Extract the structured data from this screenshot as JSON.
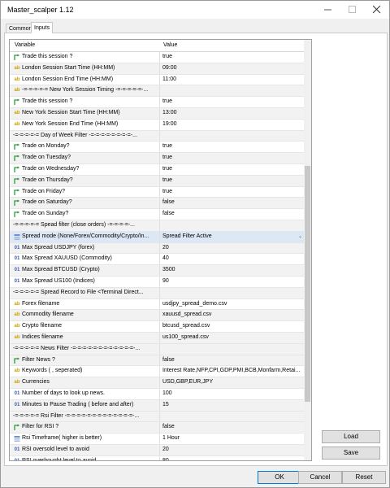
{
  "window": {
    "title": "Master_scalper 1.12"
  },
  "tabs": [
    {
      "label": "Common"
    },
    {
      "label": "Inputs"
    }
  ],
  "table": {
    "headers": {
      "variable": "Variable",
      "value": "Value"
    },
    "rows": [
      {
        "icon": "arrow",
        "variable": "Trade this session ?",
        "value": "true"
      },
      {
        "icon": "ab",
        "variable": "London Session Start Time (HH:MM)",
        "value": "09:00"
      },
      {
        "icon": "ab",
        "variable": "London Session End Time (HH:MM)",
        "value": "11:00"
      },
      {
        "icon": "ab",
        "variable": "-=-=-=-=-= New York Session Timing -=-=-=-=-=-...",
        "value": ""
      },
      {
        "icon": "arrow",
        "variable": "Trade this session ?",
        "value": "true"
      },
      {
        "icon": "ab",
        "variable": "New York Session Start Time (HH:MM)",
        "value": "13:00"
      },
      {
        "icon": "ab",
        "variable": "New York Session End Time (HH:MM)",
        "value": "19:00"
      },
      {
        "icon": "none",
        "variable": "-=-=-=-=-= Day of Week Filter -=-=-=-=-=-=-=-=-...",
        "value": ""
      },
      {
        "icon": "arrow",
        "variable": "Trade on Monday?",
        "value": "true"
      },
      {
        "icon": "arrow",
        "variable": "Trade on Tuesday?",
        "value": "true"
      },
      {
        "icon": "arrow",
        "variable": "Trade on Wednesday?",
        "value": "true"
      },
      {
        "icon": "arrow",
        "variable": "Trade on Thursday?",
        "value": "true"
      },
      {
        "icon": "arrow",
        "variable": "Trade on Friday?",
        "value": "true"
      },
      {
        "icon": "arrow",
        "variable": "Trade on Saturday?",
        "value": "false"
      },
      {
        "icon": "arrow",
        "variable": "Trade on Sunday?",
        "value": "false"
      },
      {
        "icon": "none",
        "variable": "-=-=-=-=-= Spead filter (close orders) -=-=-=-=-...",
        "value": ""
      },
      {
        "icon": "select",
        "variable": "Spread mode (None/Forex/Commodity/Crypto/In...",
        "value": "Spread Filter Active",
        "dropdown": true
      },
      {
        "icon": "01",
        "variable": "Max Spread USDJPY (forex)",
        "value": "20"
      },
      {
        "icon": "01",
        "variable": "Max Spread XAUUSD (Commodity)",
        "value": "40"
      },
      {
        "icon": "01",
        "variable": "Max Spread BTCUSD (Crypto)",
        "value": "3500"
      },
      {
        "icon": "01",
        "variable": "Max Spread US100 (Indices)",
        "value": "90"
      },
      {
        "icon": "none",
        "variable": "-=-=-=-=-= Spread Record to File <Terminal Direct...",
        "value": ""
      },
      {
        "icon": "ab",
        "variable": "Forex filename",
        "value": "usdjpy_spread_demo.csv"
      },
      {
        "icon": "ab",
        "variable": "Commodity filename",
        "value": "xauusd_spread.csv"
      },
      {
        "icon": "ab",
        "variable": "Crypto filename",
        "value": "btcusd_spread.csv"
      },
      {
        "icon": "ab",
        "variable": "Indices filename",
        "value": "us100_spread.csv"
      },
      {
        "icon": "none",
        "variable": "-=-=-=-=-= News Filter -=-=-=-=-=-=-=-=-=-=-=-=-...",
        "value": ""
      },
      {
        "icon": "arrow",
        "variable": "Filter News ?",
        "value": "false"
      },
      {
        "icon": "ab",
        "variable": "Keywords ( , seperated)",
        "value": "Interest Rate,NFP,CPI,GDP,PMI,BCB,Monfarm,Retai..."
      },
      {
        "icon": "ab",
        "variable": "Currencies",
        "value": "USD,GBP,EUR,JPY"
      },
      {
        "icon": "01",
        "variable": "Number of days to look up news.",
        "value": "100"
      },
      {
        "icon": "01",
        "variable": "Minutes to Pause Trading ( before and after)",
        "value": "15"
      },
      {
        "icon": "none",
        "variable": "-=-=-=-=-= Rsi Filter -=-=-=-=-=-=-=-=-=-=-=-=-=-...",
        "value": ""
      },
      {
        "icon": "arrow",
        "variable": "Filter for RSI ?",
        "value": "false"
      },
      {
        "icon": "select",
        "variable": "Rsi Timeframe( higher is better)",
        "value": "1 Hour"
      },
      {
        "icon": "01",
        "variable": "RSI oversold level to avoid",
        "value": "20"
      },
      {
        "icon": "01",
        "variable": "RSI overbought level to avoid",
        "value": "80"
      }
    ]
  },
  "side_buttons": {
    "load": "Load",
    "save": "Save"
  },
  "footer_buttons": {
    "ok": "OK",
    "cancel": "Cancel",
    "reset": "Reset"
  }
}
